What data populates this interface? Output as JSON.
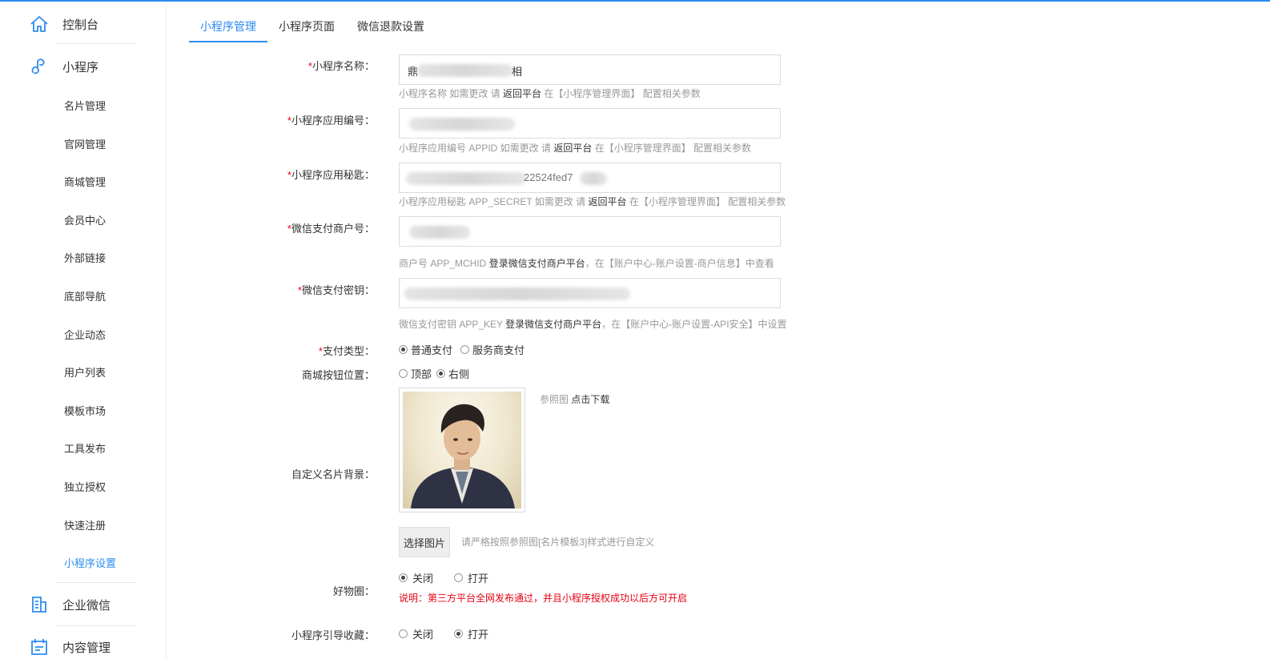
{
  "sidebar": {
    "dashboard": "控制台",
    "miniprogram": "小程序",
    "items": [
      "名片管理",
      "官网管理",
      "商城管理",
      "会员中心",
      "外部链接",
      "底部导航",
      "企业动态",
      "用户列表",
      "模板市场",
      "工具发布",
      "独立授权",
      "快速注册",
      "小程序设置"
    ],
    "active_item": "小程序设置",
    "wechat_work": "企业微信",
    "content": "内容管理"
  },
  "tabs": [
    "小程序管理",
    "小程序页面",
    "微信退款设置"
  ],
  "form": {
    "name": {
      "label": "小程序名称：",
      "value": "鼎",
      "value_tail": "相",
      "hint_pre": "小程序名称 如需更改 请",
      "hint_link": "返回平台",
      "hint_post": "在【小程序管理界面】 配置相关参数"
    },
    "appid": {
      "label": "小程序应用编号：",
      "hint_pre": "小程序应用编号 APPID 如需更改 请",
      "hint_link": "返回平台",
      "hint_post": "在【小程序管理界面】 配置相关参数"
    },
    "secret": {
      "label": "小程序应用秘匙：",
      "value_tail": "22524fed7",
      "hint_pre": "小程序应用秘匙 APP_SECRET 如需更改 请",
      "hint_link": "返回平台",
      "hint_post": "在【小程序管理界面】 配置相关参数"
    },
    "mchid": {
      "label": "微信支付商户号：",
      "hint_pre": "商户号 APP_MCHID",
      "hint_link": "登录微信支付商户平台",
      "hint_post": "，在【账户中心-账户设置-商户信息】中查看"
    },
    "paykey": {
      "label": "微信支付密钥：",
      "hint_pre": "微信支付密钥 APP_KEY",
      "hint_link": "登录微信支付商户平台",
      "hint_post": "，在【账户中心-账户设置-API安全】中设置"
    },
    "pay_type": {
      "label": "支付类型：",
      "options": [
        "普通支付",
        "服务商支付"
      ],
      "selected": 0
    },
    "shop_btn": {
      "label": "商城按钮位置：",
      "options": [
        "顶部",
        "右侧"
      ],
      "selected": 1
    },
    "card_bg": {
      "label": "自定义名片背景：",
      "ref_pre": "参照图",
      "ref_link": "点击下载",
      "choose": "选择图片",
      "choose_hint": "请严格按照参照图[名片模板3]样式进行自定义"
    },
    "goods_circle": {
      "label": "好物圈：",
      "options": [
        "关闭",
        "打开"
      ],
      "selected": 0,
      "warn": "说明：第三方平台全网发布通过，并且小程序授权成功以后方可开启"
    },
    "guide_fav": {
      "label": "小程序引导收藏：",
      "options": [
        "关闭",
        "打开"
      ],
      "selected": 1
    }
  },
  "colors": {
    "accent": "#2d8cf0",
    "required": "#e60012"
  }
}
